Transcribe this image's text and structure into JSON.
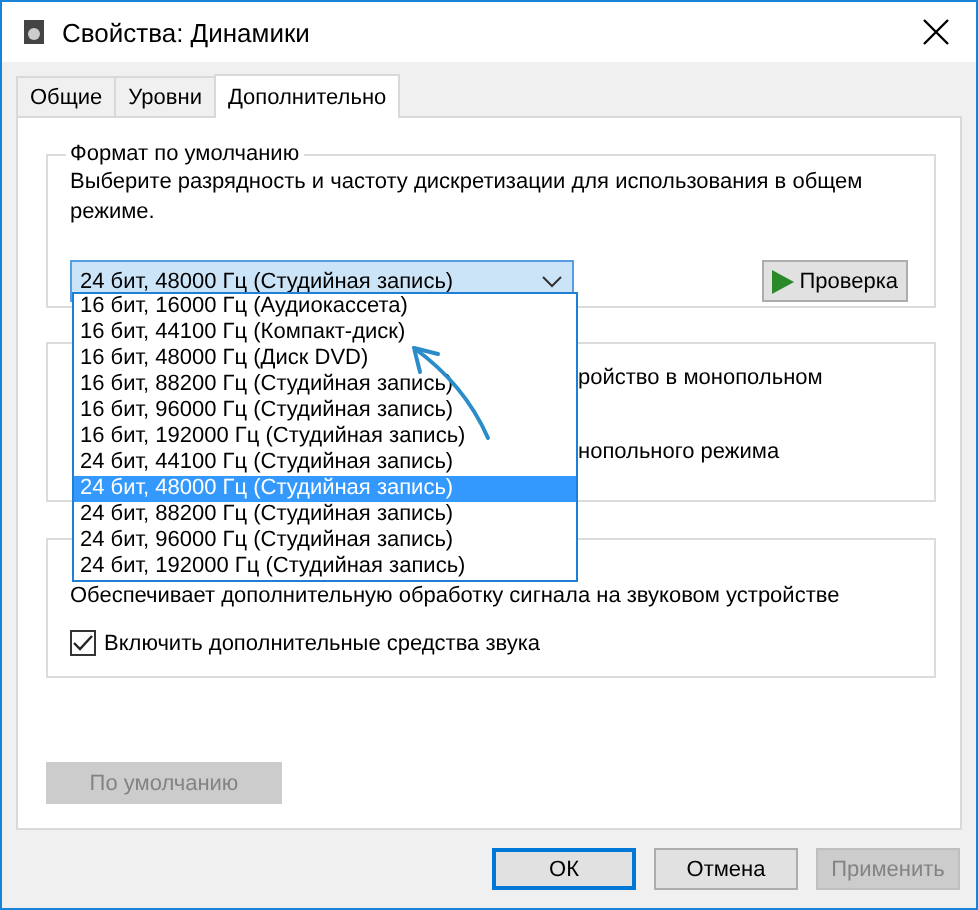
{
  "window": {
    "title": "Свойства: Динамики"
  },
  "tabs": [
    {
      "label": "Общие",
      "selected": false
    },
    {
      "label": "Уровни",
      "selected": false
    },
    {
      "label": "Дополнительно",
      "selected": true
    }
  ],
  "format_group": {
    "title": "Формат по умолчанию",
    "description": "Выберите разрядность и частоту дискретизации для использования в общем режиме.",
    "combo": {
      "value": "24 бит, 48000 Гц (Студийная запись)",
      "expanded": true
    },
    "test_button": "Проверка",
    "dropdown_items": [
      {
        "label": "16 бит, 16000 Гц (Аудиокассета)",
        "selected": false
      },
      {
        "label": "16 бит, 44100 Гц (Компакт-диск)",
        "selected": false
      },
      {
        "label": "16 бит, 48000 Гц (Диск DVD)",
        "selected": false
      },
      {
        "label": "16 бит, 88200 Гц (Студийная запись)",
        "selected": false
      },
      {
        "label": "16 бит, 96000 Гц (Студийная запись)",
        "selected": false
      },
      {
        "label": "16 бит, 192000 Гц (Студийная запись)",
        "selected": false
      },
      {
        "label": "24 бит, 44100 Гц (Студийная запись)",
        "selected": false
      },
      {
        "label": "24 бит, 48000 Гц (Студийная запись)",
        "selected": true
      },
      {
        "label": "24 бит, 88200 Гц (Студийная запись)",
        "selected": false
      },
      {
        "label": "24 бит, 96000 Гц (Студийная запись)",
        "selected": false
      },
      {
        "label": "24 бит, 192000 Гц (Студийная запись)",
        "selected": false
      }
    ]
  },
  "exclusive_group": {
    "lines": [
      "ройство в монопольном",
      "нопольного режима"
    ]
  },
  "enhancements_group": {
    "description": "Обеспечивает дополнительную обработку сигнала на звуковом устройстве",
    "checkbox": {
      "label": "Включить дополнительные средства звука",
      "checked": true
    }
  },
  "default_button": {
    "label": "По умолчанию",
    "disabled": true
  },
  "buttons": [
    {
      "label": "ОК",
      "kind": "default"
    },
    {
      "label": "Отмена",
      "kind": "normal"
    },
    {
      "label": "Применить",
      "kind": "disabled"
    }
  ]
}
